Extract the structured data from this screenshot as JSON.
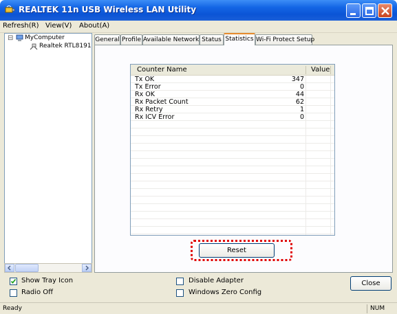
{
  "window": {
    "title": "REALTEK 11n USB Wireless LAN Utility"
  },
  "menu": {
    "refresh": "Refresh(R)",
    "view": "View(V)",
    "about": "About(A)"
  },
  "tree": {
    "root": "MyComputer",
    "child": "Realtek RTL8191",
    "root_toggle": "⊟"
  },
  "tabs": [
    {
      "label": "General"
    },
    {
      "label": "Profile"
    },
    {
      "label": "Available Network"
    },
    {
      "label": "Status"
    },
    {
      "label": "Statistics"
    },
    {
      "label": "Wi-Fi Protect Setup"
    }
  ],
  "active_tab": "Statistics",
  "stats": {
    "headers": {
      "name": "Counter Name",
      "value": "Value"
    },
    "rows": [
      {
        "name": "Tx OK",
        "value": "347"
      },
      {
        "name": "Tx Error",
        "value": "0"
      },
      {
        "name": "Rx OK",
        "value": "44"
      },
      {
        "name": "Rx Packet Count",
        "value": "62"
      },
      {
        "name": "Rx Retry",
        "value": "1"
      },
      {
        "name": "Rx ICV Error",
        "value": "0"
      }
    ]
  },
  "buttons": {
    "reset": "Reset",
    "close": "Close"
  },
  "options": {
    "show_tray_icon": {
      "label": "Show Tray Icon",
      "checked": true
    },
    "radio_off": {
      "label": "Radio Off",
      "checked": false
    },
    "disable_adapter": {
      "label": "Disable Adapter",
      "checked": false
    },
    "windows_zero_config": {
      "label": "Windows Zero Config",
      "checked": false
    }
  },
  "status": {
    "text": "Ready",
    "num": "NUM"
  },
  "colors": {
    "titlebar": "#0b54d6",
    "active_tab_accent": "#e68b2c",
    "reset_highlight": "#e00000"
  },
  "icons": {
    "app": "wireless-adapter-icon",
    "computer": "computer-icon",
    "adapter": "network-adapter-icon",
    "minimize": "minimize-icon",
    "maximize": "maximize-icon",
    "close": "close-icon"
  }
}
